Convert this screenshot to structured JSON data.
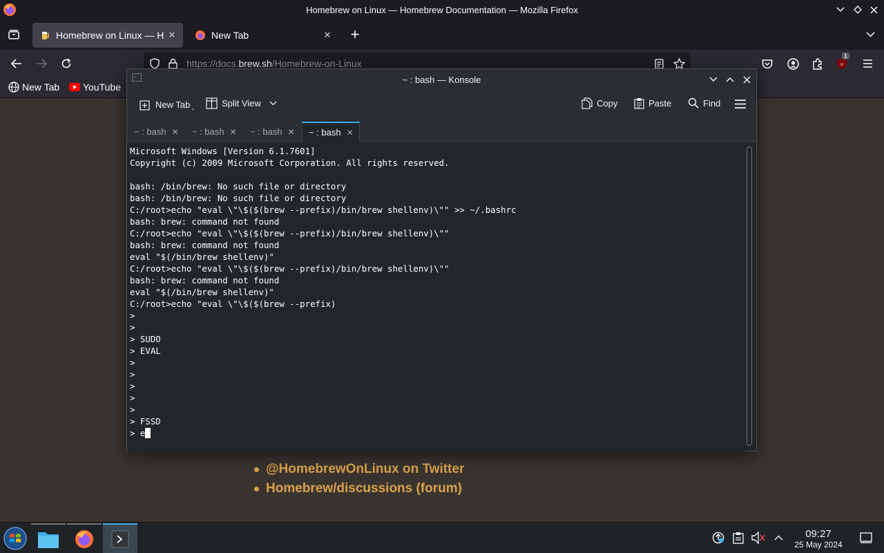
{
  "firefox": {
    "window_title": "Homebrew on Linux — Homebrew Documentation — Mozilla Firefox",
    "tabs": [
      {
        "label": "Homebrew on Linux — H",
        "close": "✕"
      },
      {
        "label": "New Tab",
        "close": "✕"
      }
    ],
    "new_tab_symbol": "+",
    "url_prefix": "https://docs.",
    "url_domain": "brew.sh",
    "url_path": "/Homebrew-on-Linux",
    "extension_badge": "1",
    "bookmarks": [
      {
        "label": "New Tab"
      },
      {
        "label": "YouTube"
      }
    ],
    "page_links": [
      {
        "label": "@HomebrewOnLinux on Twitter"
      },
      {
        "label": "Homebrew/discussions (forum)"
      }
    ]
  },
  "konsole": {
    "window_title": "~ : bash — Konsole",
    "toolbar": {
      "new_tab": "New Tab",
      "split_view": "Split View",
      "copy": "Copy",
      "paste": "Paste",
      "find": "Find"
    },
    "tabs": [
      {
        "label": "~ : bash"
      },
      {
        "label": "~ : bash"
      },
      {
        "label": "~ : bash"
      },
      {
        "label": "~ : bash"
      }
    ],
    "terminal_text": "Microsoft Windows [Version 6.1.7601]\nCopyright (c) 2009 Microsoft Corporation. All rights reserved.\n\nbash: /bin/brew: No such file or directory\nbash: /bin/brew: No such file or directory\nC:/root>echo \"eval \\\"\\$($(brew --prefix)/bin/brew shellenv)\\\"\" >> ~/.bashrc\nbash: brew: command not found\nC:/root>echo \"eval \\\"\\$($(brew --prefix)/bin/brew shellenv)\\\"\"\nbash: brew: command not found\neval \"$(/bin/brew shellenv)\"\nC:/root>echo \"eval \\\"\\$($(brew --prefix)/bin/brew shellenv)\\\"\"\nbash: brew: command not found\neval \"$(/bin/brew shellenv)\"\nC:/root>echo \"eval \\\"\\$($(brew --prefix)\n>\n>\n> SUDO\n> EVAL\n>\n>\n>\n>\n>\n> FSSD\n> e"
  },
  "taskbar": {
    "time": "09:27",
    "date": "25 May 2024"
  }
}
